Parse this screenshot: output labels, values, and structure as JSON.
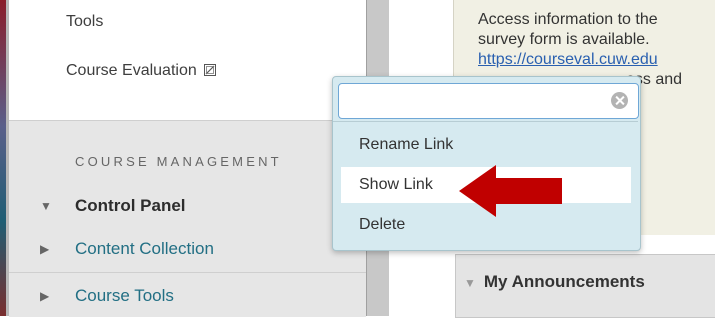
{
  "course_menu": {
    "links": [
      {
        "label": "Tools"
      },
      {
        "label": "Course Evaluation",
        "icon": "hidden-link-icon"
      }
    ],
    "section_heading": "COURSE MANAGEMENT",
    "control_panel": {
      "label": "Control Panel",
      "expanded": true
    },
    "items": [
      {
        "label": "Content Collection"
      },
      {
        "label": "Course Tools"
      }
    ]
  },
  "info_box": {
    "line1": "Access information to the",
    "line2": "survey form is available.",
    "line3_link": "https://courseval.cuw.edu",
    "line4": "ess and"
  },
  "announcements": {
    "title": "My Announcements"
  },
  "context_menu": {
    "search_value": "",
    "items": [
      {
        "label": "Rename Link"
      },
      {
        "label": "Show Link",
        "highlighted": true
      },
      {
        "label": "Delete"
      }
    ]
  },
  "annotation": {
    "arrow_color": "#c00000"
  },
  "colors": {
    "menu_link": "#226f84",
    "popup_bg": "#d6eaf0",
    "info_bg": "#f1f0e4"
  }
}
